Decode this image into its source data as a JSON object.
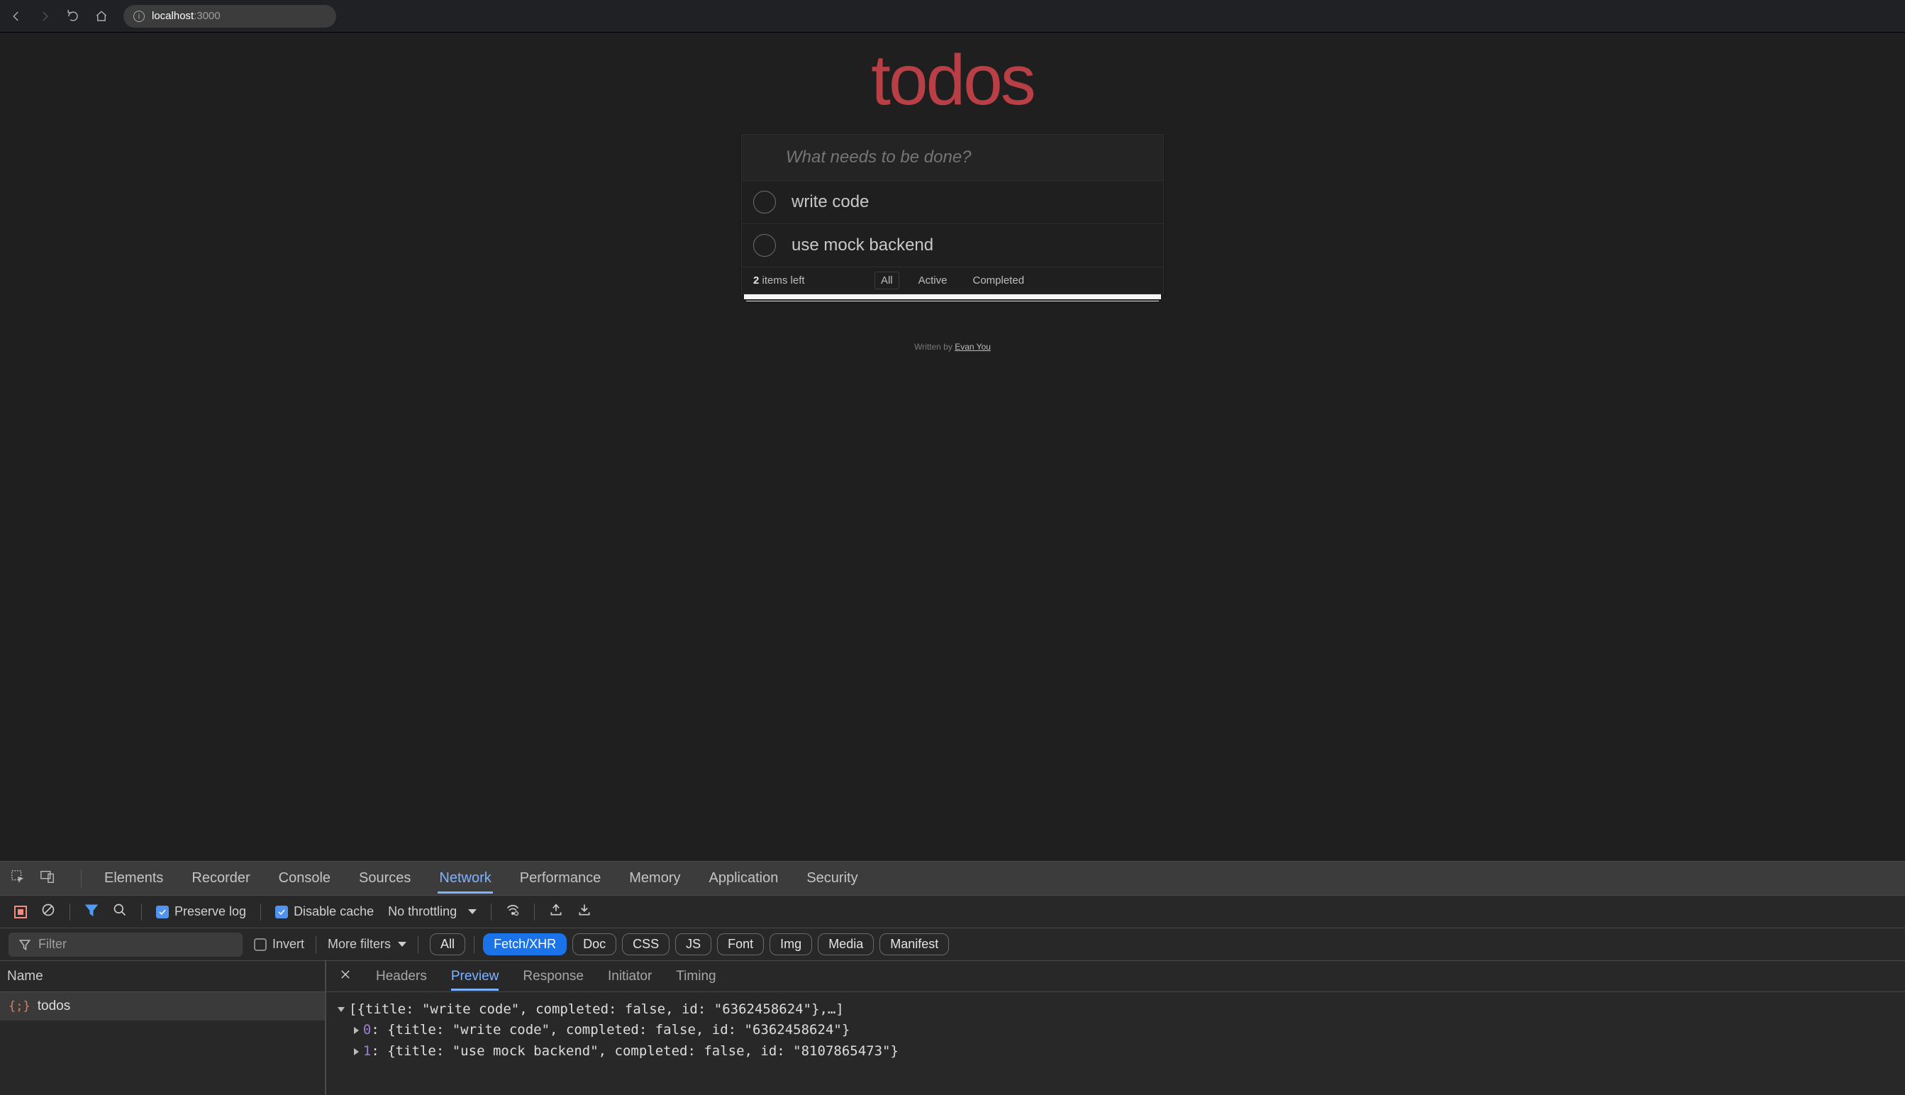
{
  "browser": {
    "url_host": "localhost",
    "url_port": ":3000"
  },
  "app": {
    "title": "todos",
    "placeholder": "What needs to be done?",
    "items": [
      {
        "label": "write code"
      },
      {
        "label": "use mock backend"
      }
    ],
    "count_strong": "2",
    "count_rest": " items left",
    "filters": {
      "all": "All",
      "active": "Active",
      "completed": "Completed"
    },
    "credits_prefix": "Written by ",
    "credits_link": "Evan You"
  },
  "devtools": {
    "tabs": [
      "Elements",
      "Recorder",
      "Console",
      "Sources",
      "Network",
      "Performance",
      "Memory",
      "Application",
      "Security"
    ],
    "active_tab": "Network",
    "toolbar": {
      "preserve_log": "Preserve log",
      "disable_cache": "Disable cache",
      "throttling": "No throttling"
    },
    "filter_row": {
      "filter_placeholder": "Filter",
      "invert": "Invert",
      "more_filters": "More filters",
      "pills": [
        "All",
        "Fetch/XHR",
        "Doc",
        "CSS",
        "JS",
        "Font",
        "Img",
        "Media",
        "Manifest"
      ],
      "active_pill": "Fetch/XHR"
    },
    "requests": {
      "col_name": "Name",
      "rows": [
        {
          "name": "todos"
        }
      ]
    },
    "detail": {
      "tabs": [
        "Headers",
        "Preview",
        "Response",
        "Initiator",
        "Timing"
      ],
      "active_tab": "Preview",
      "preview": {
        "summary": "[{title: \"write code\", completed: false, id: \"6362458624\"},…]",
        "entries": [
          {
            "index": "0",
            "text": "{title: \"write code\", completed: false, id: \"6362458624\"}"
          },
          {
            "index": "1",
            "text": "{title: \"use mock backend\", completed: false, id: \"8107865473\"}"
          }
        ]
      }
    }
  }
}
